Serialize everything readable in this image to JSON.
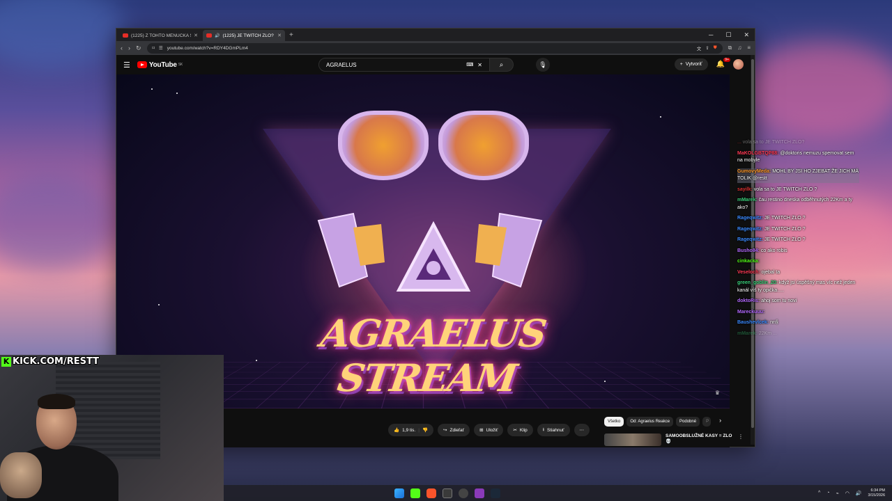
{
  "browser": {
    "tabs": [
      {
        "label": "(1225) Z TOHTO MENUČKA SA TI ZA..."
      },
      {
        "label": "(1225) JE TWITCH ZLO? - You..."
      }
    ],
    "url": "youtube.com/watch?v=RDY4DGmPLm4"
  },
  "youtube": {
    "logo": "YouTube",
    "logo_badge": "SK",
    "search_query": "AGRAELUS",
    "create_label": "Vytvoriť",
    "notification_count": "9+"
  },
  "video": {
    "title_art": "AGRAELUS STREAM"
  },
  "actions": {
    "like_count": "1,9 tis.",
    "share": "Zdieľať",
    "save": "Uložiť",
    "clip": "Klip",
    "download": "Stiahnuť"
  },
  "chips": [
    "Všetko",
    "Od: Agraelus Reakce",
    "Podobné",
    "P"
  ],
  "recommendation": {
    "title": "SAMOOBSLUŽNÉ KASY = ZLO 💀"
  },
  "chat": [
    {
      "user": "...",
      "message": "vola sa to JE TWITCH ZLO?",
      "color": "#d33",
      "faded": true
    },
    {
      "user": "MaKOLGBTQP88:",
      "message": "@doktoris nemuzu spemovat sem na mobyle",
      "color": "#ff3a55"
    },
    {
      "user": "GumovyMeda:",
      "message": "MOHL BY JSI HO ZJEBAT ŽE JICH MÁ TOLIK @restt",
      "color": "#ff9a2a",
      "highlight": true
    },
    {
      "user": "sayilk:",
      "message": "vola sa to JE TWITCH ZLO ?",
      "color": "#d33"
    },
    {
      "user": "mMarek:",
      "message": "čau restino dneska odběhnutých 22Km a ty ako?",
      "color": "#3ad07a"
    },
    {
      "user": "Rageqwitz:",
      "message": "JE TWITCH ZLO ?",
      "color": "#3a8aff"
    },
    {
      "user": "Rageqwitz:",
      "message": "JE TWITCH ZLO ?",
      "color": "#3a8aff"
    },
    {
      "user": "Rageqwitz:",
      "message": "JE TWITCH ZLO ?",
      "color": "#3a8aff"
    },
    {
      "user": "Busho84:",
      "message": "co ako robis",
      "color": "#b46aff"
    },
    {
      "user": "cinkacka:",
      "message": "",
      "color": "#53fc18"
    },
    {
      "user": "Veseloch:",
      "message": "ojebal ta",
      "color": "#ff3a55"
    },
    {
      "user": "green_goblin_20:",
      "message": "když jsi úspěšný mas víc než jeden kanál víš ty opička.....",
      "color": "#3ad07a"
    },
    {
      "user": "doktoRis:",
      "message": "ahoj som tu novi",
      "color": "#b46aff"
    },
    {
      "user": "Mareckuuu:",
      "message": "",
      "color": "#b46aff"
    },
    {
      "user": "Baushevlcek:",
      "message": "nn§",
      "color": "#3a8aff"
    },
    {
      "user": "mMarek:",
      "message": "22Km ...",
      "color": "#3ad07a",
      "faded": true
    }
  ],
  "overlay": {
    "kick_text": "KICK.COM/RESTT"
  },
  "taskbar": {
    "time": "6:34 PM",
    "date": "3/15/2026"
  }
}
